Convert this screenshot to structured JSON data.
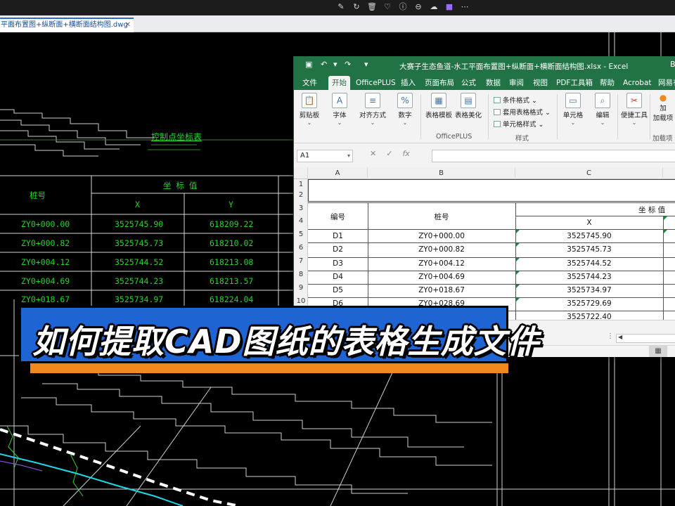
{
  "cad": {
    "tab_title": "平面布置图+纵断面+横断面结构图.dwg",
    "tab_close": "✕",
    "table_title": "控制点坐标表",
    "header_pile": "桩号",
    "header_coord": "坐 标 值",
    "header_x": "X",
    "header_y": "Y",
    "rows": [
      {
        "pile": "ZY0+000.00",
        "x": "3525745.90",
        "y": "618209.22"
      },
      {
        "pile": "ZY0+000.82",
        "x": "3525745.73",
        "y": "618210.02"
      },
      {
        "pile": "ZY0+004.12",
        "x": "3525744.52",
        "y": "618213.08"
      },
      {
        "pile": "ZY0+004.69",
        "x": "3525744.23",
        "y": "618213.57"
      },
      {
        "pile": "ZY0+018.67",
        "x": "3525734.97",
        "y": "618224.04"
      }
    ]
  },
  "excel": {
    "title": "大赛子生态鱼道-水工平面布置图+纵断面+横断面结构图.xlsx  -  Excel",
    "title_right": "B",
    "menu_tabs": [
      "文件",
      "开始",
      "OfficePLUS",
      "插入",
      "页面布局",
      "公式",
      "数据",
      "审阅",
      "视图",
      "PDF工具箱",
      "帮助",
      "Acrobat",
      "网易有"
    ],
    "active_tab": "开始",
    "ribbon": {
      "paste": "剪贴板",
      "font": "字体",
      "align": "对齐方式",
      "number": "数字",
      "table_template": "表格模板",
      "table_beautify": "表格美化",
      "officeplus_group": "OfficePLUS",
      "cond_format": "条件格式",
      "table_format": "套用表格格式",
      "cell_style": "单元格样式",
      "styles_group": "样式",
      "cells": "单元格",
      "edit": "编辑",
      "quick_tools": "便捷工具",
      "add_load": "加载项",
      "add_load_group": "加载项",
      "add_load_top": "加"
    },
    "name_box": "A1",
    "columns": [
      "A",
      "B",
      "C"
    ],
    "row_numbers": [
      "1",
      "2",
      "3",
      "4",
      "5",
      "6",
      "7",
      "8",
      "9",
      "10"
    ],
    "header_id": "编号",
    "header_pile": "桩号",
    "header_coord": "坐 标 值",
    "header_x": "X",
    "rows": [
      {
        "id": "D1",
        "pile": "ZY0+000.00",
        "x": "3525745.90"
      },
      {
        "id": "D2",
        "pile": "ZY0+000.82",
        "x": "3525745.73"
      },
      {
        "id": "D3",
        "pile": "ZY0+004.12",
        "x": "3525744.52"
      },
      {
        "id": "D4",
        "pile": "ZY0+004.69",
        "x": "3525744.23"
      },
      {
        "id": "D5",
        "pile": "ZY0+018.67",
        "x": "3525734.97"
      },
      {
        "id": "D6",
        "pile": "ZY0+028.69",
        "x": "3525729.69"
      },
      {
        "id": "",
        "pile": "",
        "x": "3525722.40"
      }
    ]
  },
  "banner": {
    "text": "如何提取CAD图纸的表格生成文件"
  },
  "colors": {
    "excel_green": "#217346",
    "cad_green": "#24d62a",
    "banner_blue": "#1e64d2",
    "banner_orange": "#f08a1e"
  }
}
